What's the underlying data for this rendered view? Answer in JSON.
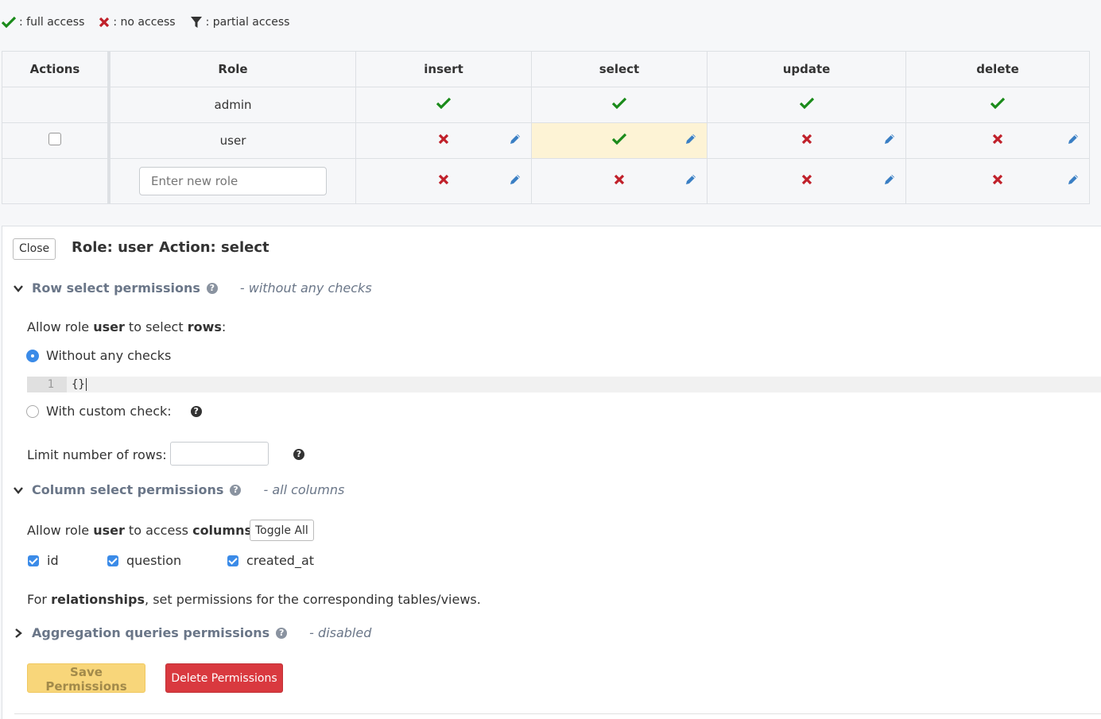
{
  "legend": {
    "full": ": full access",
    "none": ": no access",
    "partial": ": partial access"
  },
  "table": {
    "headers": [
      "Actions",
      "Role",
      "insert",
      "select",
      "update",
      "delete"
    ],
    "rows": [
      {
        "role": "admin",
        "perms": [
          "full",
          "full",
          "full",
          "full"
        ]
      },
      {
        "role": "user",
        "perms": [
          "none",
          "full",
          "none",
          "none"
        ]
      }
    ],
    "new_role_placeholder": "Enter new role",
    "new_role_perms": [
      "none",
      "none",
      "none",
      "none"
    ]
  },
  "panel": {
    "close_label": "Close",
    "role_header": "Role: user",
    "action_header": "Action: select",
    "row_section": {
      "title": "Row select permissions",
      "note": "- without any checks",
      "allow_prefix": "Allow role ",
      "allow_role": "user",
      "allow_mid": " to select ",
      "allow_obj": "rows",
      "allow_suffix": ":",
      "option_without": "Without any checks",
      "editor_line": "1",
      "editor_code": "{}",
      "option_custom": "With custom check:"
    },
    "limit_label": "Limit number of rows:",
    "column_section": {
      "title": "Column select permissions",
      "note": "- all columns",
      "allow_prefix": "Allow role ",
      "allow_role": "user",
      "allow_mid": " to access ",
      "allow_obj": "columns",
      "allow_suffix": ":",
      "toggle_label": "Toggle All",
      "columns": [
        "id",
        "question",
        "created_at"
      ]
    },
    "relationships": {
      "prefix": "For ",
      "bold": "relationships",
      "suffix": ", set permissions for the corresponding tables/views."
    },
    "aggregation": {
      "title": "Aggregation queries permissions",
      "note": "- disabled"
    },
    "save_label": "Save Permissions",
    "delete_label": "Delete Permissions"
  },
  "colors": {
    "full": "#1a8a1a",
    "none": "#c0202a",
    "edit": "#3a7fc4",
    "highlight": "#fdf3d5"
  }
}
